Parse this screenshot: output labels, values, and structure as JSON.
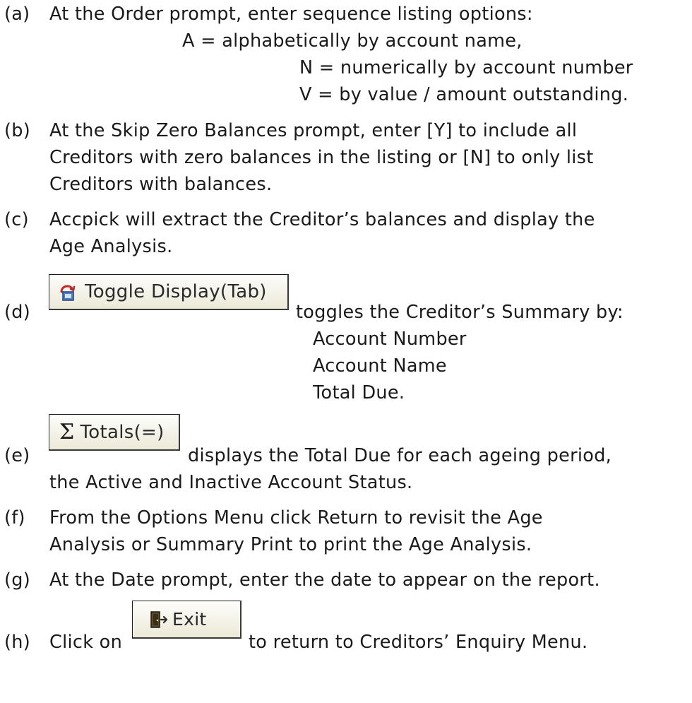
{
  "items": {
    "a": {
      "label": "(a)",
      "line1": "At the Order prompt, enter sequence listing options:",
      "opt_a": "A = alphabetically by account name,",
      "opt_n": "N = numerically by account number",
      "opt_v": "V = by value / amount outstanding."
    },
    "b": {
      "label": "(b)",
      "line1": "At the Skip Zero Balances prompt, enter [Y] to include all",
      "line2": "Creditors with zero balances in the listing or [N] to only list",
      "line3": "Creditors with balances."
    },
    "c": {
      "label": "(c)",
      "line1": "Accpick will extract the Creditor’s balances and display the",
      "line2": "Age Analysis."
    },
    "d": {
      "label": "(d)",
      "button_label": "Toggle Display(Tab)",
      "button_icon": "toggle-display-icon",
      "after_button": "toggles the Creditor’s Summary by:",
      "list": [
        "Account Number",
        "Account Name",
        "Total Due."
      ]
    },
    "e": {
      "label": "(e)",
      "button_label": "Totals(=)",
      "button_icon": "sigma-icon",
      "after_button": "displays the Total Due for each ageing period,",
      "line2": "the Active and Inactive Account Status."
    },
    "f": {
      "label": "(f)",
      "line1": "From the Options Menu click Return to revisit the Age",
      "line2": "Analysis or Summary Print to print the Age Analysis."
    },
    "g": {
      "label": "(g)",
      "line1": "At the Date prompt, enter the date to appear on the report."
    },
    "h": {
      "label": "(h)",
      "before_button": "Click on",
      "button_label": "Exit",
      "button_icon": "exit-door-icon",
      "after_button": "to return to Creditors’ Enquiry Menu."
    }
  }
}
